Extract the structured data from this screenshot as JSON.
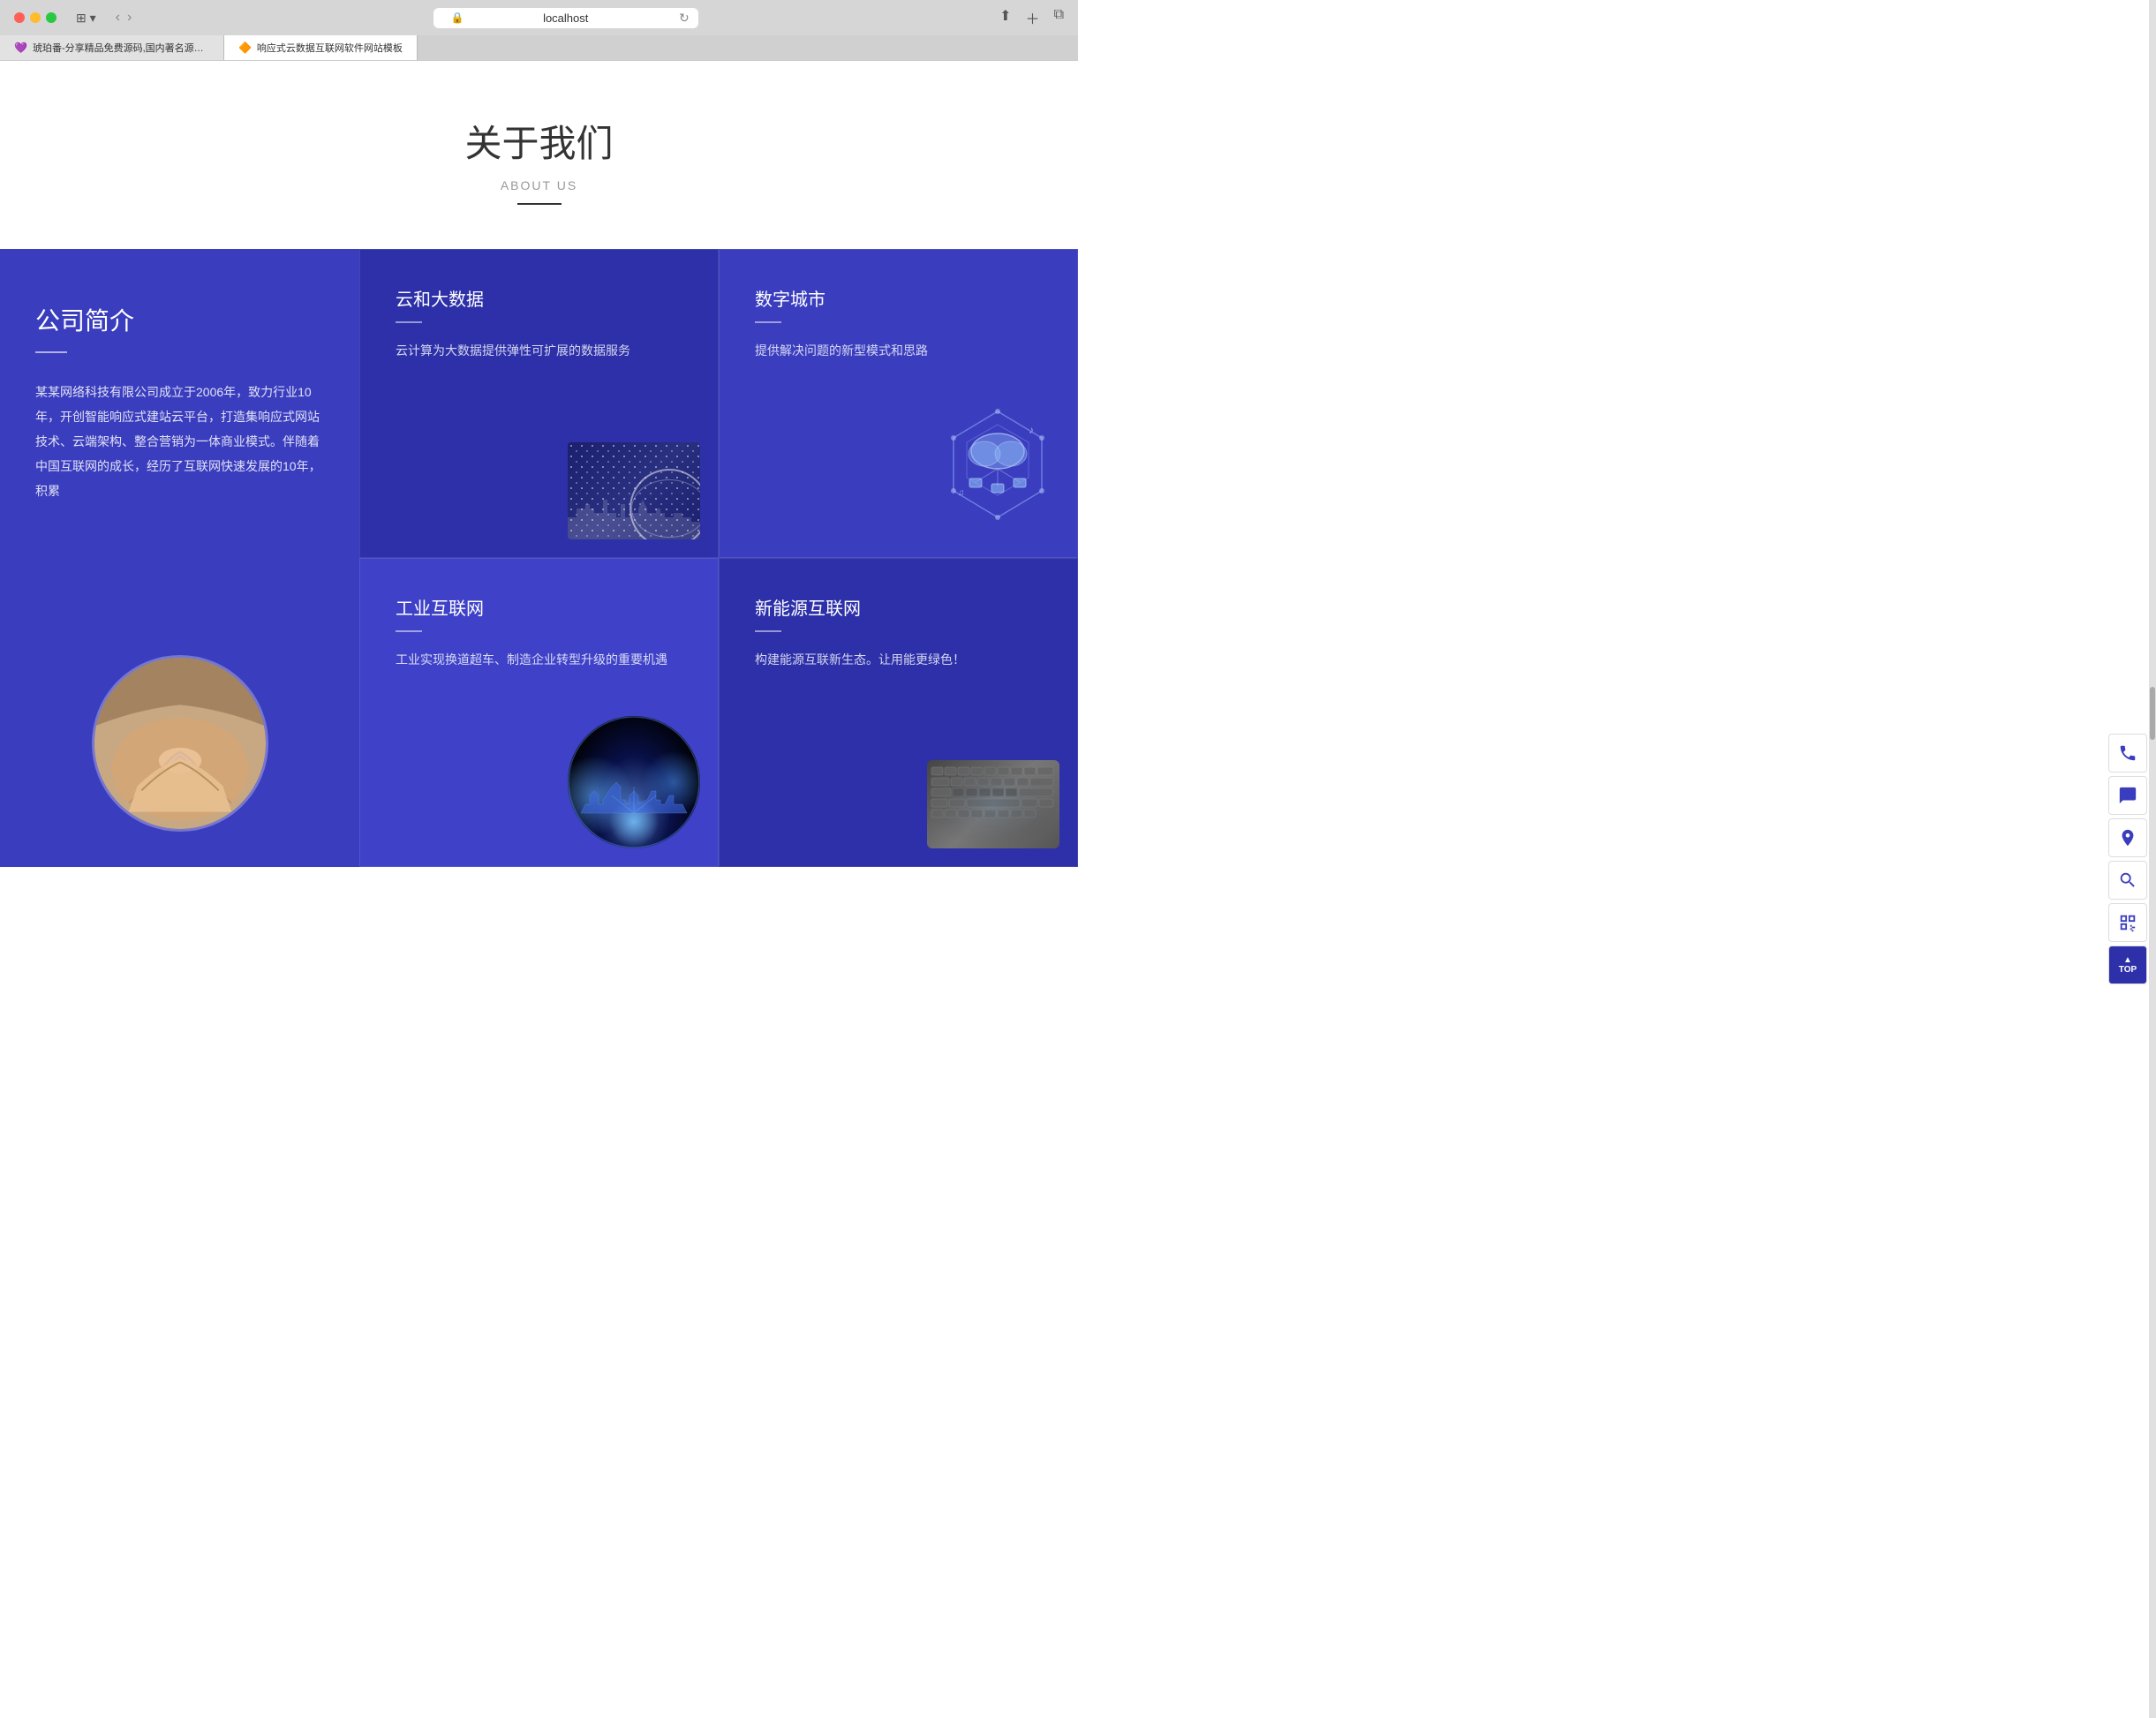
{
  "browser": {
    "url": "localhost",
    "tab1_label": "琥珀番-分享精品免费源码,国内著名源码社区！",
    "tab2_label": "响应式云数据互联网软件网站模板",
    "tab1_icon": "💜",
    "tab2_icon": "🔶"
  },
  "about": {
    "title": "关于我们",
    "subtitle": "ABOUT US"
  },
  "company": {
    "title": "公司简介",
    "description": "某某网络科技有限公司成立于2006年，致力行业10年，开创智能响应式建站云平台，打造集响应式网站技术、云端架构、整合营销为一体商业模式。伴随着中国互联网的成长，经历了互联网快速发展的10年，积累"
  },
  "cards": [
    {
      "title": "云和大数据",
      "description": "云计算为大数据提供弹性可扩展的数据服务"
    },
    {
      "title": "数字城市",
      "description": "提供解决问题的新型模式和思路"
    },
    {
      "title": "工业互联网",
      "description": "工业实现换道超车、制造企业转型升级的重要机遇"
    },
    {
      "title": "新能源互联网",
      "description": "构建能源互联新生态。让用能更绿色！"
    }
  ],
  "float_buttons": {
    "phone": "📞",
    "chat": "💬",
    "location": "📍",
    "search": "🔍",
    "qr": "⊞",
    "top_label": "TOP"
  }
}
